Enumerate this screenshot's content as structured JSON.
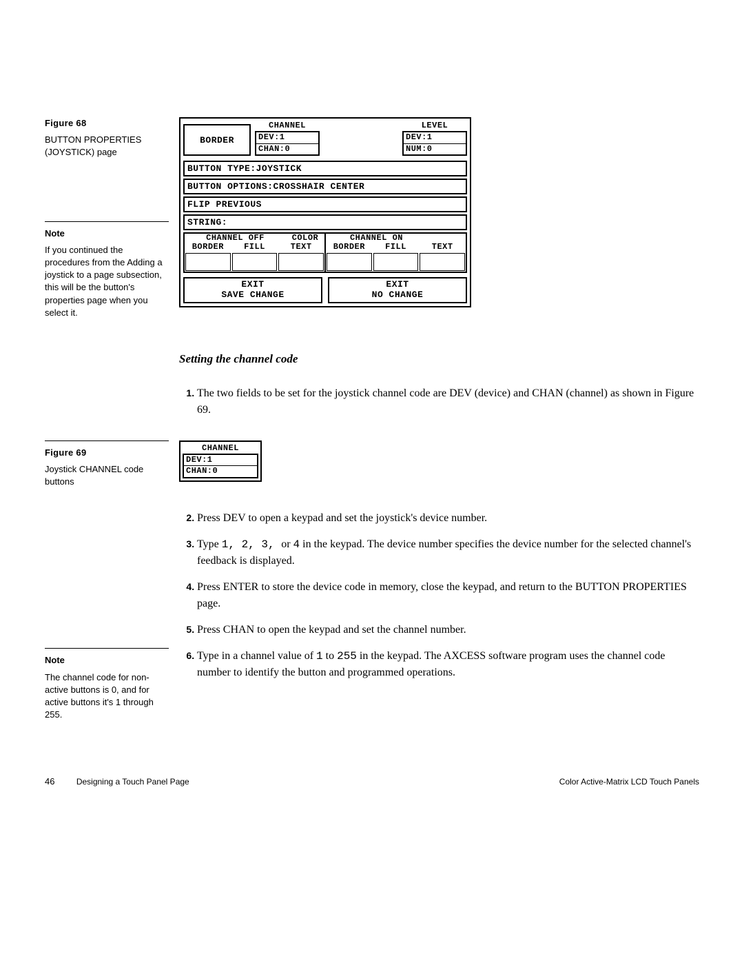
{
  "figure68": {
    "label": "Figure 68",
    "caption": "BUTTON PROPERTIES (JOYSTICK) page",
    "panel": {
      "border_btn": "BORDER",
      "channel": {
        "label": "CHANNEL",
        "dev": "DEV:1",
        "chan": "CHAN:0"
      },
      "level": {
        "label": "LEVEL",
        "dev": "DEV:1",
        "num": "NUM:0"
      },
      "type": "BUTTON TYPE:JOYSTICK",
      "options": "BUTTON OPTIONS:CROSSHAIR CENTER",
      "flip": "FLIP  PREVIOUS",
      "string": "STRING:",
      "color_center": "COLOR",
      "off": {
        "title": "CHANNEL OFF",
        "border": "BORDER",
        "fill": "FILL",
        "text": "TEXT"
      },
      "on": {
        "title": "CHANNEL ON",
        "border": "BORDER",
        "fill": "FILL",
        "text": "TEXT"
      },
      "exit_save": {
        "l1": "EXIT",
        "l2": "SAVE CHANGE"
      },
      "exit_no": {
        "l1": "EXIT",
        "l2": "NO CHANGE"
      }
    }
  },
  "note1": {
    "title": "Note",
    "body": "If you continued the procedures from the Adding a joystick to a page subsection, this will be the button's properties page when you select it."
  },
  "section_title": "Setting the channel code",
  "step1": "The two fields to be set for the joystick channel code are DEV (device) and CHAN (channel) as shown in Figure 69.",
  "figure69": {
    "label": "Figure 69",
    "caption": "Joystick CHANNEL code buttons",
    "panel": {
      "label": "CHANNEL",
      "dev": "DEV:1",
      "chan": "CHAN:0"
    }
  },
  "step2": "Press DEV to open a keypad and set the joystick's device number.",
  "step3a": "Type ",
  "step3_codes": "1, 2, 3, ",
  "step3_or": "or ",
  "step3_code4": "4",
  "step3b": " in the keypad. The device number specifies the device number for the selected channel's feedback is displayed.",
  "step4": "Press ENTER to store the device code in memory, close the keypad, and return to the BUTTON PROPERTIES page.",
  "step5": "Press CHAN to open the keypad and set the channel number.",
  "step6a": "Type in a channel value of ",
  "step6_code1": "1",
  "step6_to": " to ",
  "step6_code2": "255",
  "step6b": " in the keypad. The AXCESS software program uses the channel code number to identify the button and programmed operations.",
  "note2": {
    "title": "Note",
    "body": "The channel code for non-active buttons is 0, and for active buttons it's 1 through 255."
  },
  "footer": {
    "pageno": "46",
    "left": "Designing a Touch Panel Page",
    "right": "Color Active-Matrix LCD Touch Panels"
  }
}
